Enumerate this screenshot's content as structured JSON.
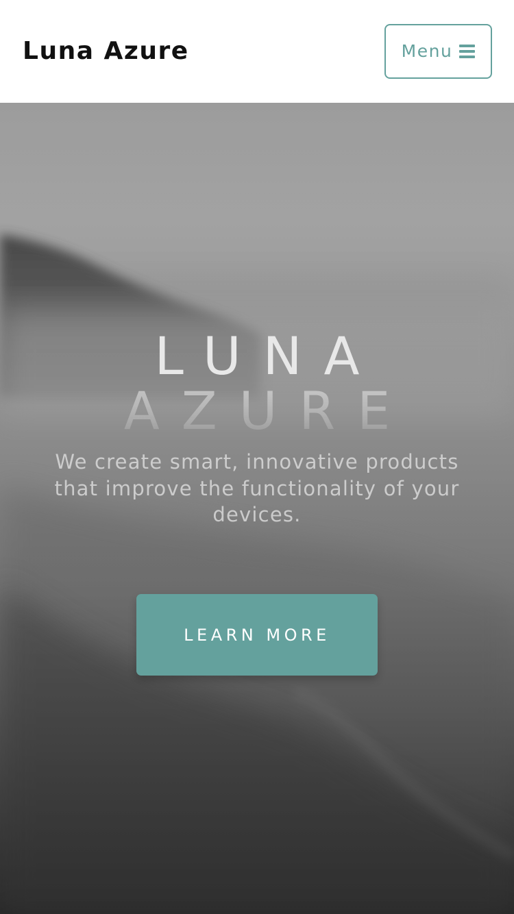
{
  "navbar": {
    "brand": "Luna Azure",
    "menu_label": "Menu",
    "menu_icon": "bars-icon",
    "accent_color": "#64a19d"
  },
  "hero": {
    "title_line_1": "LUNA",
    "title_line_2": "AZURE",
    "subtitle": "We create smart, innovative products that improve the functionality of your devices.",
    "cta_label": "LEARN MORE",
    "background_image": "misty coastline hills grayscale"
  }
}
